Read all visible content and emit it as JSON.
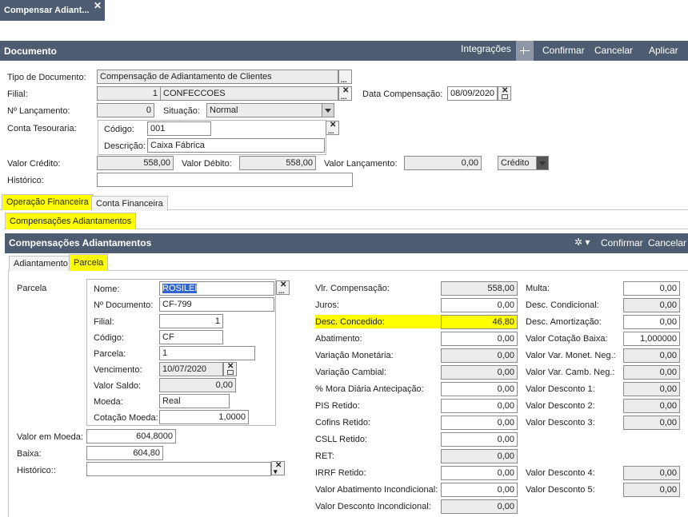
{
  "window_tab": {
    "title": "Compensar Adiant...",
    "close": "✕"
  },
  "toolbar": {
    "title": "Documento",
    "integracoes": "Integrações",
    "confirmar": "Confirmar",
    "cancelar": "Cancelar",
    "aplicar": "Aplicar"
  },
  "form": {
    "tipo_documento": {
      "label": "Tipo de Documento:",
      "value": "Compensação de Adiantamento de Clientes"
    },
    "filial": {
      "label": "Filial:",
      "code": "1",
      "name": "CONFECCOES"
    },
    "data_compensacao": {
      "label": "Data Compensação:",
      "value": "08/09/2020"
    },
    "n_lancamento": {
      "label": "Nº Lançamento:",
      "value": "0"
    },
    "situacao": {
      "label": "Situação:",
      "value": "Normal"
    },
    "conta_tesouraria": {
      "label": "Conta Tesouraria:",
      "codigo_label": "Código:",
      "codigo": "001",
      "descricao_label": "Descrição:",
      "descricao": "Caixa Fábrica"
    },
    "valor_credito": {
      "label": "Valor Crédito:",
      "value": "558,00"
    },
    "valor_debito": {
      "label": "Valor Débito:",
      "value": "558,00"
    },
    "valor_lancamento": {
      "label": "Valor Lançamento:",
      "value": "0,00"
    },
    "tipo_lancamento": {
      "value": "Crédito"
    },
    "historico": {
      "label": "Histórico:",
      "value": ""
    }
  },
  "tabs": [
    "Operação Financeira",
    "Conta Financeira"
  ],
  "subtabs": [
    "Compensações Adiantamentos"
  ],
  "comp": {
    "title": "Compensações Adiantamentos",
    "confirmar": "Confirmar",
    "cancelar": "Cancelar",
    "tabs": [
      "Adiantamento",
      "Parcela"
    ]
  },
  "parcela": {
    "group_label": "Parcela",
    "nome": {
      "label": "Nome:",
      "value": "ROSILEI"
    },
    "n_documento": {
      "label": "Nº Documento:",
      "value": "CF-799"
    },
    "filial": {
      "label": "Filial:",
      "value": "1"
    },
    "codigo": {
      "label": "Código:",
      "value": "CF"
    },
    "parcela": {
      "label": "Parcela:",
      "value": "1"
    },
    "vencimento": {
      "label": "Vencimento:",
      "value": "10/07/2020"
    },
    "valor_saldo": {
      "label": "Valor Saldo:",
      "value": "0,00"
    },
    "moeda": {
      "label": "Moeda:",
      "value": "Real"
    },
    "cotacao_moeda": {
      "label": "Cotação Moeda:",
      "value": "1,0000"
    },
    "valor_em_moeda": {
      "label": "Valor em Moeda:",
      "value": "604,8000"
    },
    "baixa": {
      "label": "Baixa:",
      "value": "604,80"
    },
    "historico": {
      "label": "Histórico::",
      "value": ""
    }
  },
  "valores_mid": [
    {
      "label": "Vlr. Compensação:",
      "value": "558,00",
      "ro": true
    },
    {
      "label": "Juros:",
      "value": "0,00",
      "ro": false
    },
    {
      "label": "Desc. Concedido:",
      "value": "46,80",
      "ro": false,
      "hl": true
    },
    {
      "label": "Abatimento:",
      "value": "0,00",
      "ro": false
    },
    {
      "label": "Variação Monetária:",
      "value": "0,00",
      "ro": true
    },
    {
      "label": "Variação Cambial:",
      "value": "0,00",
      "ro": true
    },
    {
      "label": "% Mora Diária Antecipação:",
      "value": "0,00",
      "ro": false
    },
    {
      "label": "PIS Retido:",
      "value": "0,00",
      "ro": false
    },
    {
      "label": "Cofins Retido:",
      "value": "0,00",
      "ro": false
    },
    {
      "label": "CSLL Retido:",
      "value": "0,00",
      "ro": false
    },
    {
      "label": "RET:",
      "value": "0,00",
      "ro": true
    },
    {
      "label": "IRRF Retido:",
      "value": "0,00",
      "ro": false
    },
    {
      "label": "Valor Abatimento Incondicional:",
      "value": "0,00",
      "ro": false
    },
    {
      "label": "Valor Desconto Incondicional:",
      "value": "0,00",
      "ro": true
    }
  ],
  "valores_right": [
    {
      "label": "Multa:",
      "value": "0,00",
      "ro": false,
      "row": 0
    },
    {
      "label": "Desc. Condicional:",
      "value": "0,00",
      "ro": true,
      "row": 1
    },
    {
      "label": "Desc. Amortização:",
      "value": "0,00",
      "ro": false,
      "row": 2
    },
    {
      "label": "Valor Cotação Baixa:",
      "value": "1,000000",
      "ro": false,
      "row": 3
    },
    {
      "label": "Valor Var. Monet. Neg.:",
      "value": "0,00",
      "ro": true,
      "row": 4
    },
    {
      "label": "Valor Var. Camb. Neg.:",
      "value": "0,00",
      "ro": true,
      "row": 5
    },
    {
      "label": "Valor Desconto 1:",
      "value": "0,00",
      "ro": true,
      "row": 6
    },
    {
      "label": "Valor Desconto 2:",
      "value": "0,00",
      "ro": true,
      "row": 7
    },
    {
      "label": "Valor Desconto 3:",
      "value": "0,00",
      "ro": true,
      "row": 8
    },
    {
      "label": "Valor Desconto 4:",
      "value": "0,00",
      "ro": true,
      "row": 11
    },
    {
      "label": "Valor Desconto 5:",
      "value": "0,00",
      "ro": true,
      "row": 12
    }
  ]
}
